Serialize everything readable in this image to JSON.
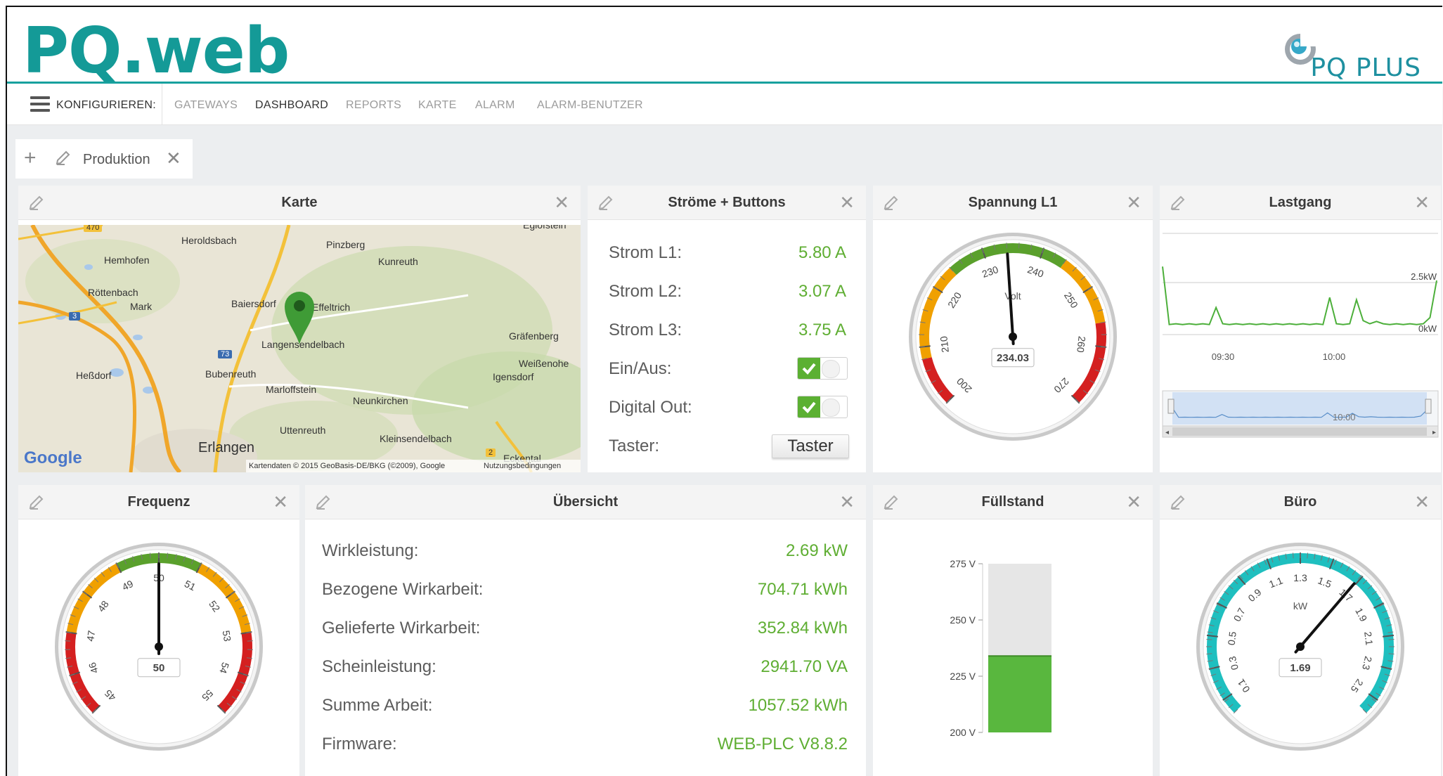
{
  "app": {
    "logo": "PQ.web",
    "brand": "PQ PLUS"
  },
  "nav": {
    "menu_label": "KONFIGURIEREN:",
    "items": [
      "GATEWAYS",
      "DASHBOARD",
      "REPORTS",
      "KARTE",
      "ALARM",
      "ALARM-BENUTZER"
    ],
    "active": "DASHBOARD"
  },
  "tabs": [
    {
      "label": "Produktion"
    }
  ],
  "widgets": {
    "karte": {
      "title": "Karte",
      "places": [
        "Heroldsbach",
        "Hemhofen",
        "Pinzberg",
        "Kunreuth",
        "Röttenbach",
        "Mark",
        "Baiersdorf",
        "Effeltrich",
        "Langensendelbach",
        "Gräfenberg",
        "Weißenohe",
        "Igensdorf",
        "Heßdorf",
        "Bubenreuth",
        "Marloffstein",
        "Neunkirchen",
        "Uttenreuth",
        "Kleinsendelbach",
        "Erlangen",
        "Eckental",
        "Eglofstein"
      ],
      "road_labels": [
        "470",
        "3",
        "73",
        "2"
      ],
      "google": "Google",
      "attribution": "Kartendaten © 2015 GeoBasis-DE/BKG (©2009), Google",
      "terms": "Nutzungsbedingungen"
    },
    "stroeme": {
      "title": "Ströme + Buttons",
      "rows": [
        {
          "label": "Strom L1:",
          "value": "5.80 A"
        },
        {
          "label": "Strom L2:",
          "value": "3.07 A"
        },
        {
          "label": "Strom L3:",
          "value": "3.75 A"
        }
      ],
      "toggles": [
        {
          "label": "Ein/Aus:",
          "on": true
        },
        {
          "label": "Digital Out:",
          "on": true
        }
      ],
      "taster": {
        "label": "Taster:",
        "button": "Taster"
      }
    },
    "spannung": {
      "title": "Spannung L1",
      "unit": "Volt",
      "value": 234.03,
      "display": "234.03",
      "min": 200,
      "max": 270,
      "ticks": [
        "200",
        "210",
        "220",
        "230",
        "240",
        "250",
        "260",
        "270"
      ]
    },
    "lastgang": {
      "title": "Lastgang",
      "y_labels": [
        "2.5kW",
        "0kW"
      ],
      "x_labels": [
        "09:30",
        "10:00"
      ],
      "navigator_label": "10:00",
      "series": [
        0.88,
        0.13,
        0.14,
        0.13,
        0.14,
        0.13,
        0.14,
        0.13,
        0.35,
        0.14,
        0.13,
        0.14,
        0.13,
        0.14,
        0.13,
        0.14,
        0.13,
        0.14,
        0.13,
        0.14,
        0.13,
        0.14,
        0.13,
        0.14,
        0.13,
        0.48,
        0.14,
        0.13,
        0.14,
        0.45,
        0.18,
        0.14,
        0.17,
        0.14,
        0.13,
        0.14,
        0.13,
        0.14,
        0.13,
        0.14,
        0.22,
        0.7
      ]
    },
    "frequenz": {
      "title": "Frequenz",
      "value": 50,
      "display": "50",
      "min": 45,
      "max": 55,
      "ticks": [
        "45",
        "46",
        "47",
        "48",
        "49",
        "50",
        "51",
        "52",
        "53",
        "54",
        "55"
      ]
    },
    "uebersicht": {
      "title": "Übersicht",
      "rows": [
        {
          "label": "Wirkleistung:",
          "value": "2.69 kW"
        },
        {
          "label": "Bezogene Wirkarbeit:",
          "value": "704.71 kWh"
        },
        {
          "label": "Gelieferte Wirkarbeit:",
          "value": "352.84 kWh"
        },
        {
          "label": "Scheinleistung:",
          "value": "2941.70 VA"
        },
        {
          "label": "Summe Arbeit:",
          "value": "1057.52 kWh"
        },
        {
          "label": "Firmware:",
          "value": "WEB-PLC V8.8.2"
        }
      ]
    },
    "fuellstand": {
      "title": "Füllstand",
      "scale": [
        "275 V",
        "250 V",
        "225 V",
        "200 V"
      ],
      "min": 200,
      "max": 275,
      "value": 234
    },
    "buero": {
      "title": "Büro",
      "unit": "kW",
      "value": 1.69,
      "display": "1.69",
      "min": 0,
      "max": 2.6,
      "ticks": [
        "0.1",
        "0.3",
        "0.5",
        "0.7",
        "0.9",
        "1.1",
        "1.3",
        "1.5",
        "1.7",
        "1.9",
        "2.1",
        "2.3",
        "2.5"
      ]
    }
  },
  "colors": {
    "brand_teal": "#149a97",
    "value_green": "#5fae33",
    "gauge_green": "#5aa02c",
    "gauge_orange": "#f0a000",
    "gauge_red": "#d42020",
    "gauge_cyan": "#1fbfbf"
  }
}
